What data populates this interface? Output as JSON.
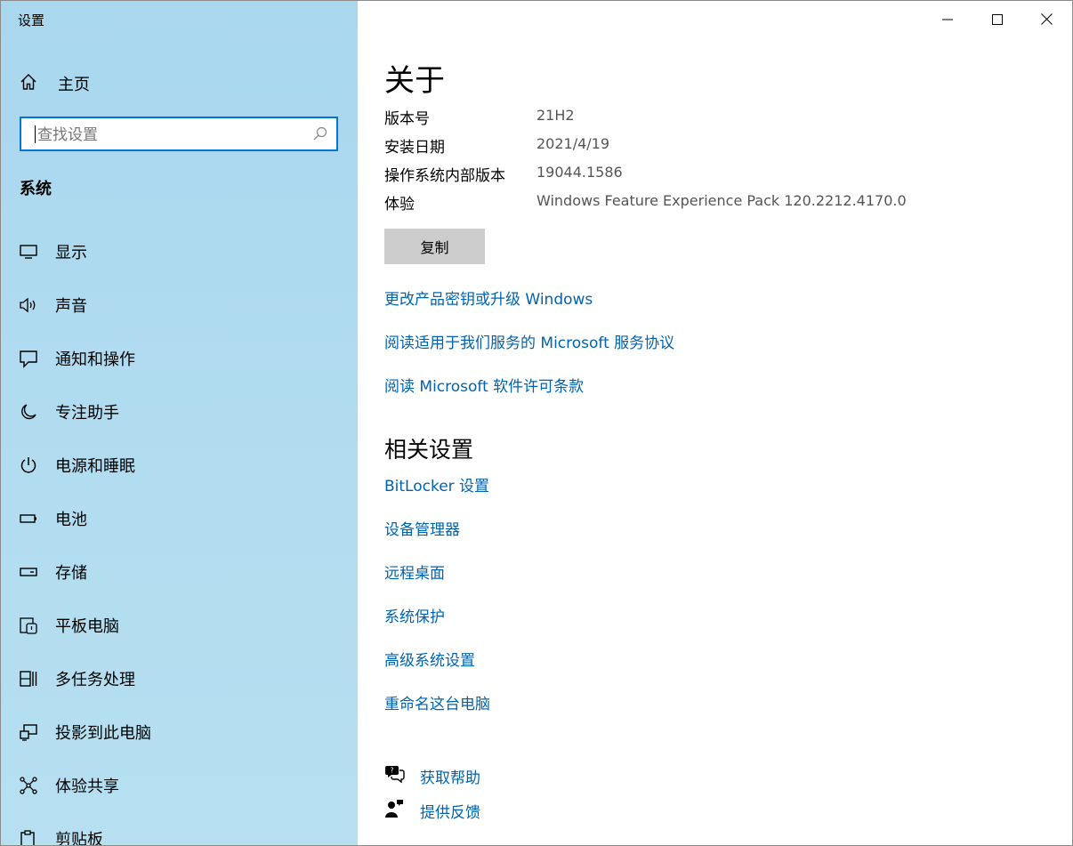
{
  "app": {
    "title": "设置"
  },
  "window_controls": {
    "minimize": "minimize-icon",
    "maximize": "maximize-icon",
    "close": "close-icon"
  },
  "sidebar": {
    "home_label": "主页",
    "search_placeholder": "查找设置",
    "section_title": "系统",
    "items": [
      {
        "label": "显示",
        "icon": "display-icon"
      },
      {
        "label": "声音",
        "icon": "speaker-icon"
      },
      {
        "label": "通知和操作",
        "icon": "notification-icon"
      },
      {
        "label": "专注助手",
        "icon": "moon-icon"
      },
      {
        "label": "电源和睡眠",
        "icon": "power-icon"
      },
      {
        "label": "电池",
        "icon": "battery-icon"
      },
      {
        "label": "存储",
        "icon": "storage-icon"
      },
      {
        "label": "平板电脑",
        "icon": "tablet-icon"
      },
      {
        "label": "多任务处理",
        "icon": "multitasking-icon"
      },
      {
        "label": "投影到此电脑",
        "icon": "project-icon"
      },
      {
        "label": "体验共享",
        "icon": "share-icon"
      },
      {
        "label": "剪贴板",
        "icon": "clipboard-icon"
      }
    ]
  },
  "main": {
    "title": "关于",
    "specs": [
      {
        "label": "版本号",
        "value": "21H2"
      },
      {
        "label": "安装日期",
        "value": "2021/4/19"
      },
      {
        "label": "操作系统内部版本",
        "value": "19044.1586"
      },
      {
        "label": "体验",
        "value": "Windows Feature Experience Pack 120.2212.4170.0"
      }
    ],
    "copy_button": "复制",
    "links": [
      "更改产品密钥或升级 Windows",
      "阅读适用于我们服务的 Microsoft 服务协议",
      "阅读 Microsoft 软件许可条款"
    ],
    "related_title": "相关设置",
    "related_links": [
      "BitLocker 设置",
      "设备管理器",
      "远程桌面",
      "系统保护",
      "高级系统设置",
      "重命名这台电脑"
    ],
    "help": [
      {
        "label": "获取帮助",
        "icon": "help-chat-icon"
      },
      {
        "label": "提供反馈",
        "icon": "feedback-icon"
      }
    ]
  },
  "colors": {
    "accent": "#0078d7",
    "link": "#0063b1",
    "sidebar_bg": "#b1dcf0",
    "button_bg": "#cccccc"
  }
}
